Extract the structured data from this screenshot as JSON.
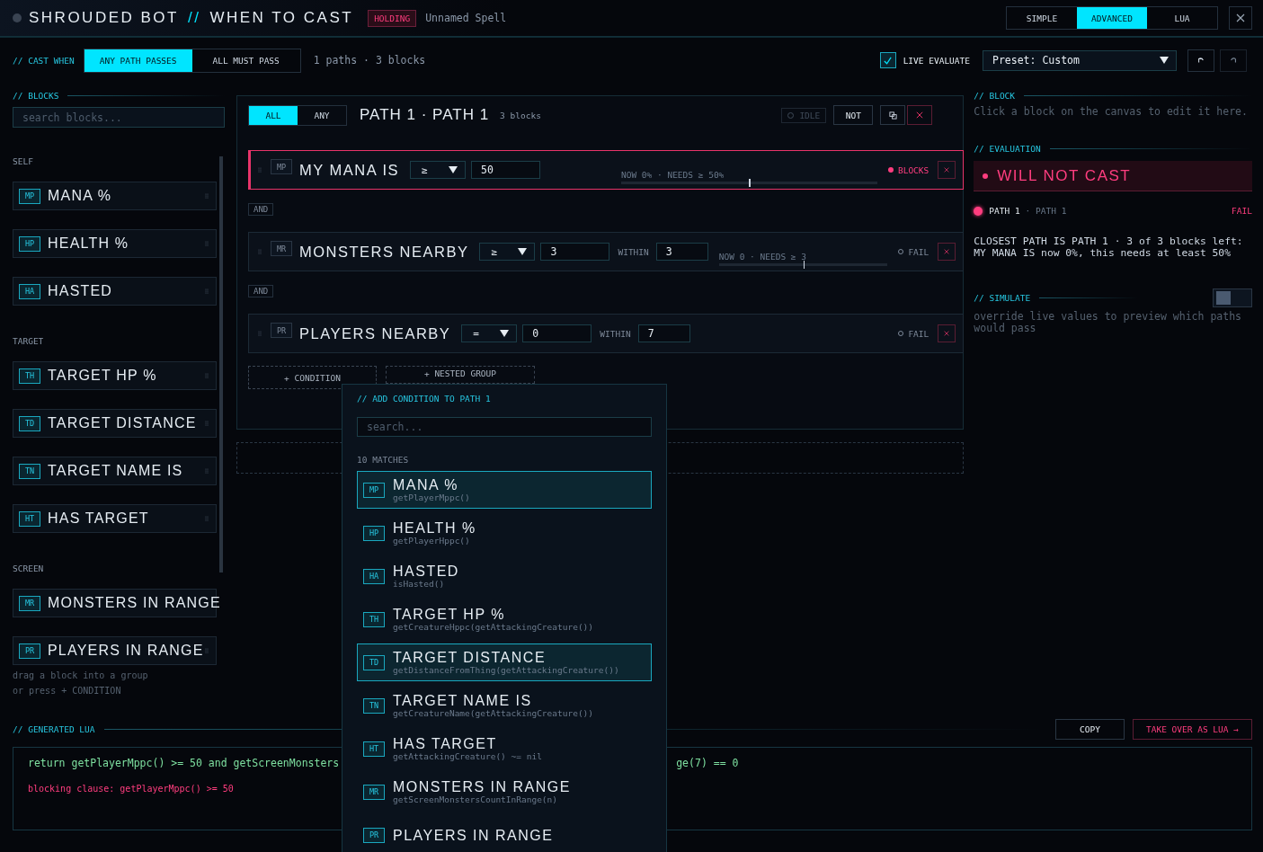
{
  "header": {
    "app": "SHROUDED BOT",
    "separator": "//",
    "page": "WHEN TO CAST",
    "status_badge": "HOLDING",
    "spell_name": "Unnamed Spell",
    "modes": [
      {
        "label": "SIMPLE",
        "selected": false
      },
      {
        "label": "ADVANCED",
        "selected": true
      },
      {
        "label": "LUA",
        "selected": false
      }
    ]
  },
  "toolbar": {
    "label": "// CAST WHEN",
    "cast_modes": [
      {
        "label": "ANY PATH PASSES",
        "selected": true
      },
      {
        "label": "ALL MUST PASS",
        "selected": false
      }
    ],
    "summary": "1 paths · 3 blocks",
    "live_evaluate": {
      "label": "LIVE EVALUATE",
      "checked": true
    },
    "preset": "Preset: Custom"
  },
  "blocks_panel": {
    "title": "// BLOCKS",
    "search_placeholder": "search blocks...",
    "groups": [
      {
        "label": "SELF",
        "items": [
          {
            "code": "MP",
            "name": "MANA %"
          },
          {
            "code": "HP",
            "name": "HEALTH %"
          },
          {
            "code": "HA",
            "name": "HASTED"
          }
        ]
      },
      {
        "label": "TARGET",
        "items": [
          {
            "code": "TH",
            "name": "TARGET HP %"
          },
          {
            "code": "TD",
            "name": "TARGET DISTANCE"
          },
          {
            "code": "TN",
            "name": "TARGET NAME IS"
          },
          {
            "code": "HT",
            "name": "HAS TARGET"
          }
        ]
      },
      {
        "label": "SCREEN",
        "items": [
          {
            "code": "MR",
            "name": "MONSTERS IN RANGE"
          },
          {
            "code": "PR",
            "name": "PLAYERS IN RANGE"
          }
        ]
      }
    ],
    "hints": [
      "drag a block into a group",
      "or press + CONDITION"
    ]
  },
  "path": {
    "match_modes": [
      {
        "label": "ALL",
        "selected": true
      },
      {
        "label": "ANY",
        "selected": false
      }
    ],
    "title": "PATH 1 · PATH 1",
    "count": "3 blocks",
    "state": "IDLE",
    "not_label": "NOT",
    "conditions": [
      {
        "code": "MP",
        "title": "MY MANA IS",
        "operator": "≥",
        "value": "50",
        "meter_text": "NOW 0% · NEEDS ≥ 50%",
        "level": 0.5,
        "blocking": true,
        "status": "BLOCKS"
      },
      {
        "joiner": "AND",
        "code": "MR",
        "title": "MONSTERS NEARBY",
        "operator": "≥",
        "value": "3",
        "within_label": "WITHIN",
        "within": "3",
        "meter_text": "NOW 0 · NEEDS ≥ 3",
        "level": 0.5,
        "blocking": false,
        "status": "FAIL"
      },
      {
        "joiner": "AND",
        "code": "PR",
        "title": "PLAYERS NEARBY",
        "operator": "=",
        "value": "0",
        "within_label": "WITHIN",
        "within": "7",
        "blocking": false,
        "status": "FAIL"
      }
    ],
    "add_buttons": [
      "+ CONDITION",
      "+ NESTED GROUP"
    ]
  },
  "block_panel": {
    "title": "// BLOCK",
    "hint": "Click a block on the canvas to edit it here."
  },
  "evaluation": {
    "title": "// EVALUATION",
    "verdict": "WILL NOT CAST",
    "paths": [
      {
        "name": "PATH 1",
        "subtitle": "· PATH 1",
        "result": "FAIL",
        "passing": false
      }
    ],
    "explanation": "CLOSEST PATH IS PATH 1 · 3 of 3 blocks left: MY MANA IS now 0%, this needs at least 50%"
  },
  "simulate": {
    "title": "// SIMULATE",
    "on": false,
    "description": "override live values to preview which paths would pass"
  },
  "lua": {
    "title": "// GENERATED LUA",
    "copy": "COPY",
    "take_over": "TAKE OVER AS LUA →",
    "code_visible": [
      "return getPlayerMppc() >= 50 and getScreenMonsters",
      "ge(7) == 0"
    ],
    "blocking_clause": "blocking clause: getPlayerMppc() >= 50"
  },
  "popup": {
    "title": "// ADD CONDITION TO PATH 1",
    "search_placeholder": "search...",
    "count": "10 MATCHES",
    "items": [
      {
        "code": "MP",
        "name": "MANA %",
        "fn": "getPlayerMppc()",
        "highlighted": true
      },
      {
        "code": "HP",
        "name": "HEALTH %",
        "fn": "getPlayerHppc()",
        "highlighted": false
      },
      {
        "code": "HA",
        "name": "HASTED",
        "fn": "isHasted()",
        "highlighted": false
      },
      {
        "code": "TH",
        "name": "TARGET HP %",
        "fn": "getCreatureHppc(getAttackingCreature())",
        "highlighted": false
      },
      {
        "code": "TD",
        "name": "TARGET DISTANCE",
        "fn": "getDistanceFromThing(getAttackingCreature())",
        "highlighted": true
      },
      {
        "code": "TN",
        "name": "TARGET NAME IS",
        "fn": "getCreatureName(getAttackingCreature())",
        "highlighted": false
      },
      {
        "code": "HT",
        "name": "HAS TARGET",
        "fn": "getAttackingCreature() ~= nil",
        "highlighted": false
      },
      {
        "code": "MR",
        "name": "MONSTERS IN RANGE",
        "fn": "getScreenMonstersCountInRange(n)",
        "highlighted": false
      },
      {
        "code": "PR",
        "name": "PLAYERS IN RANGE",
        "highlighted": false
      }
    ]
  }
}
